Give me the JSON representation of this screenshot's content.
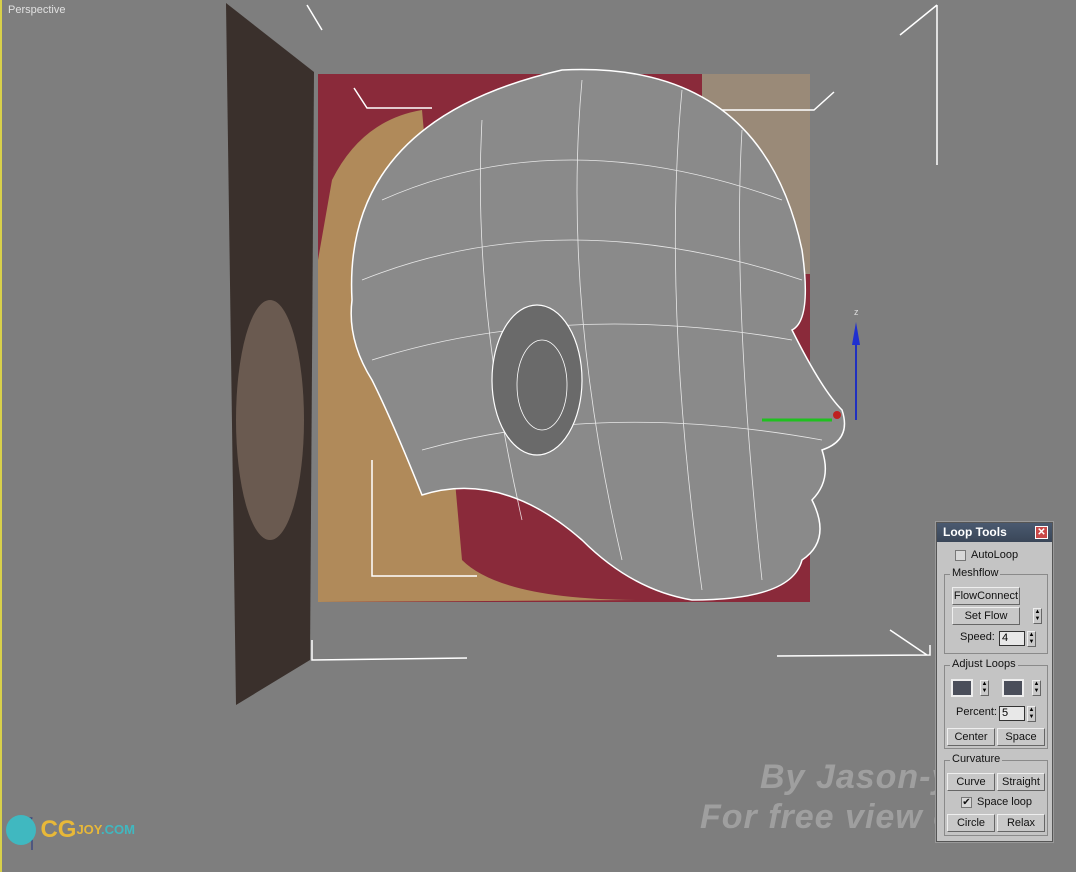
{
  "viewport": {
    "label": "Perspective",
    "axis_label": "z",
    "gizmo_axis_label": "z"
  },
  "watermark": {
    "line1": "By Jason-y",
    "line2": "For free view only"
  },
  "logo": {
    "text_cg": "CG",
    "text_joy": "JOY",
    "text_com": ".COM"
  },
  "loop_tools": {
    "title": "Loop Tools",
    "autoloop": {
      "label": "AutoLoop",
      "checked": false
    },
    "meshflow": {
      "label": "Meshflow",
      "flowconnect": "FlowConnect",
      "set_flow": "Set Flow",
      "speed_label": "Speed:",
      "speed_value": "4"
    },
    "adjust_loops": {
      "label": "Adjust Loops",
      "percent_label": "Percent:",
      "percent_value": "5",
      "center": "Center",
      "space": "Space"
    },
    "curvature": {
      "label": "Curvature",
      "curve": "Curve",
      "straight": "Straight",
      "space_loop": "Space loop",
      "space_loop_checked": true,
      "circle": "Circle",
      "relax": "Relax"
    }
  }
}
